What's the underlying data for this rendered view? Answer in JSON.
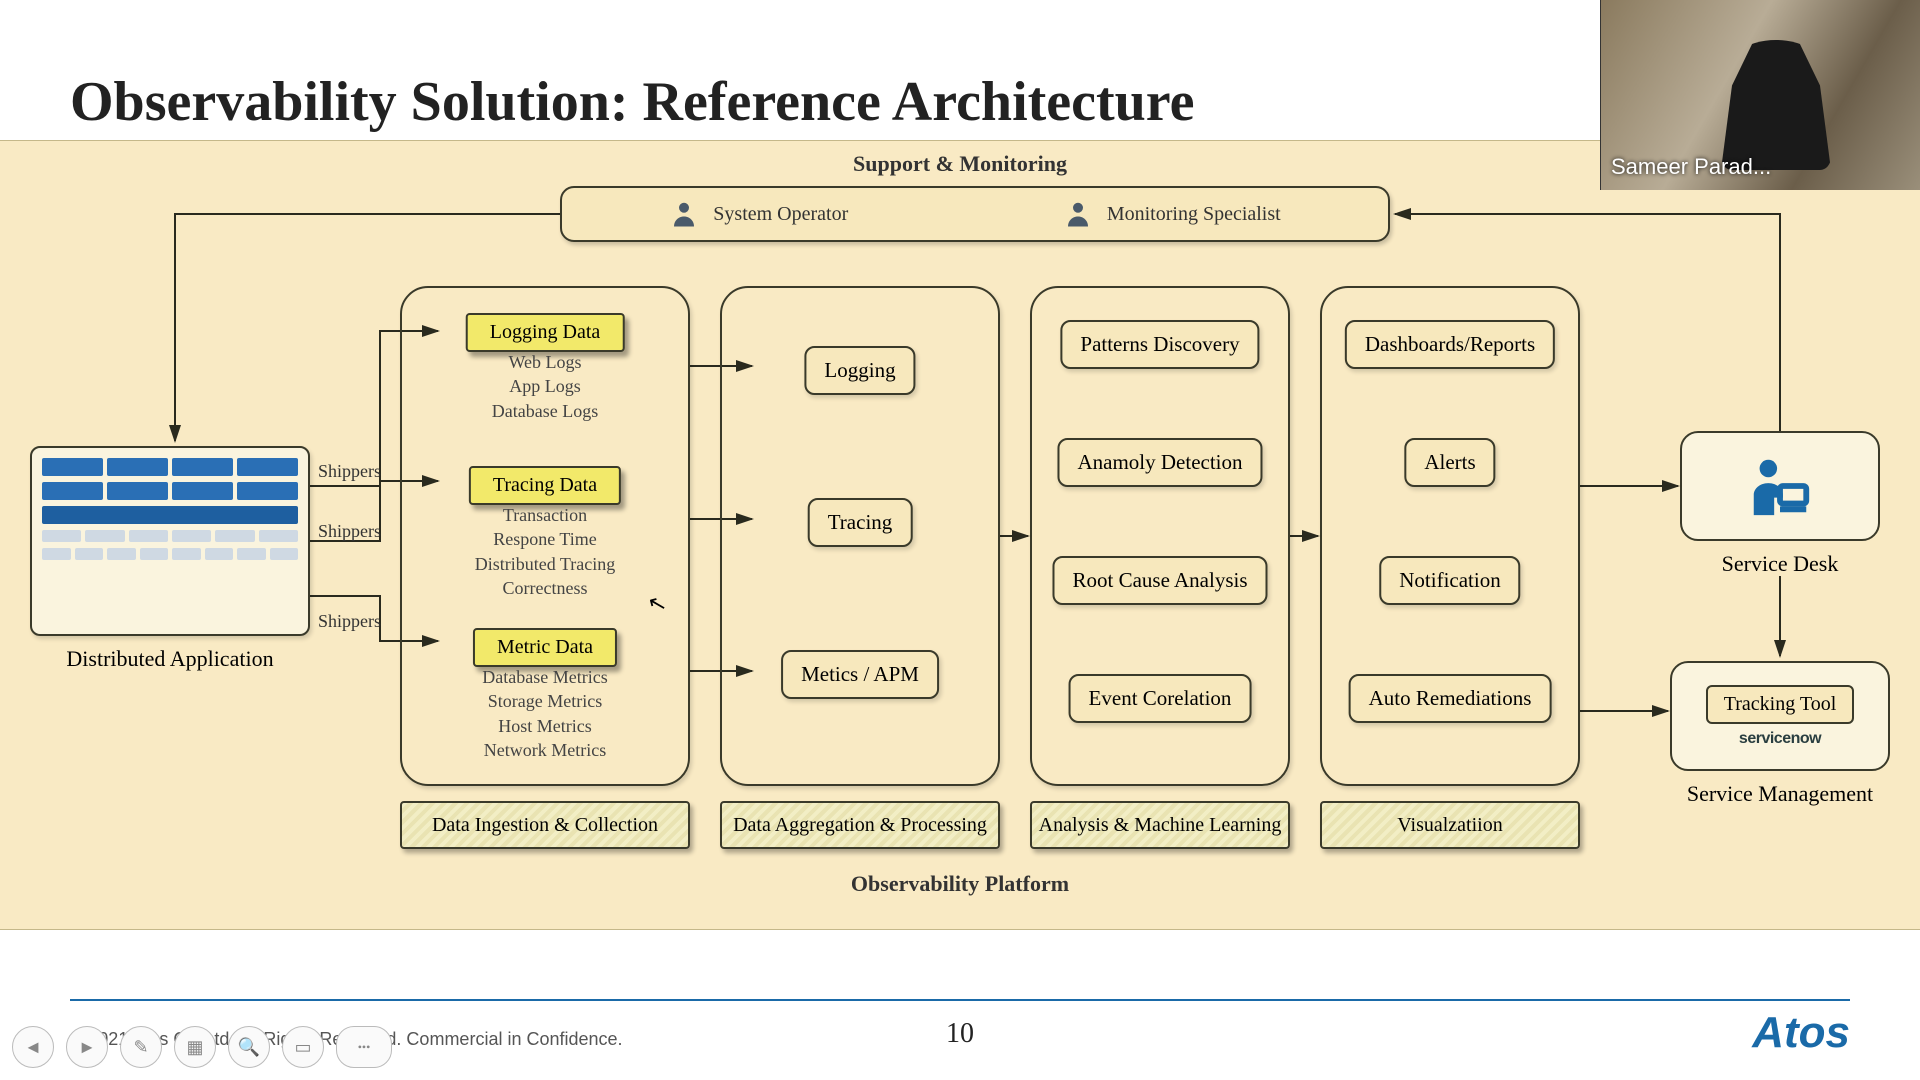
{
  "title": "Observability Solution: Reference Architecture",
  "support_label": "Support & Monitoring",
  "roles": {
    "operator": "System Operator",
    "specialist": "Monitoring Specialist"
  },
  "shippers": "Shippers",
  "dist_app": "Distributed Application",
  "col1": {
    "logging": {
      "title": "Logging Data",
      "items": [
        "Web Logs",
        "App Logs",
        "Database Logs"
      ]
    },
    "tracing": {
      "title": "Tracing Data",
      "items": [
        "Transaction",
        "Respone Time",
        "Distributed Tracing",
        "Correctness"
      ]
    },
    "metric": {
      "title": "Metric Data",
      "items": [
        "Database Metrics",
        "Storage Metrics",
        "Host Metrics",
        "Network Metrics"
      ]
    }
  },
  "col2": {
    "logging": "Logging",
    "tracing": "Tracing",
    "metrics": "Metics / APM"
  },
  "col3": {
    "a": "Patterns Discovery",
    "b": "Anamoly Detection",
    "c": "Root Cause Analysis",
    "d": "Event Corelation"
  },
  "col4": {
    "a": "Dashboards/Reports",
    "b": "Alerts",
    "c": "Notification",
    "d": "Auto Remediations"
  },
  "stages": {
    "s1": "Data Ingestion & Collection",
    "s2": "Data Aggregation & Processing",
    "s3": "Analysis & Machine Learning",
    "s4": "Visualzatiion"
  },
  "platform_label": "Observability Platform",
  "service_desk": "Service Desk",
  "tracking_tool": "Tracking Tool",
  "servicenow": "servicenow",
  "service_mgmt": "Service Management",
  "footer": {
    "copyright": "© 2021 Atos GB Ltd. All Rights Reserved. Commercial in Confidence.",
    "page": "10",
    "logo": "Atos"
  },
  "webcam_name": "Sameer Parad..."
}
